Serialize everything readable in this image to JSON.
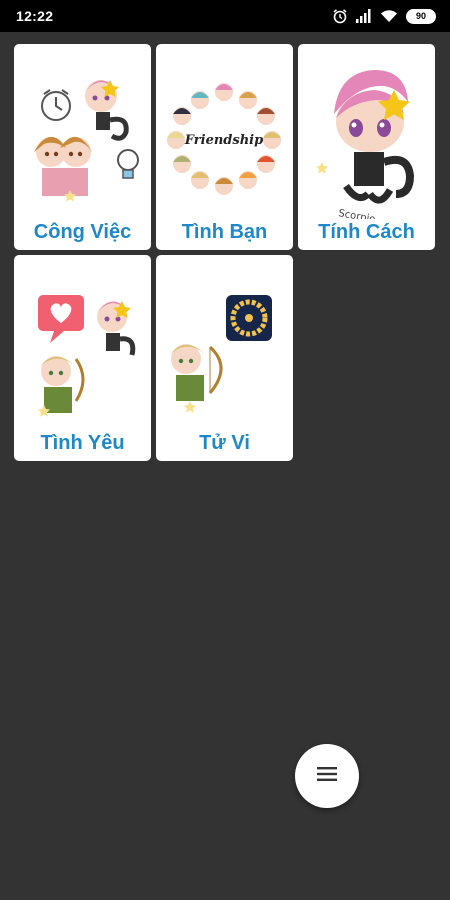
{
  "status_bar": {
    "time": "12:22",
    "battery": "90",
    "icons": [
      "alarm-icon",
      "signal-icon",
      "wifi-icon",
      "battery-icon"
    ]
  },
  "cards": [
    {
      "label": "Công Việc",
      "icon": "work-zodiac-illustration"
    },
    {
      "label": "Tình Bạn",
      "icon": "friendship-zodiac-illustration",
      "art_text": "Friendship"
    },
    {
      "label": "Tính Cách",
      "icon": "personality-zodiac-illustration",
      "art_text": "Scorpio"
    },
    {
      "label": "Tình Yêu",
      "icon": "love-zodiac-illustration"
    },
    {
      "label": "Tử Vi",
      "icon": "horoscope-zodiac-illustration"
    }
  ],
  "fab": {
    "icon": "menu-icon"
  },
  "colors": {
    "background": "#333333",
    "card": "#ffffff",
    "label": "#1e88c8",
    "status_bar": "#000000"
  }
}
